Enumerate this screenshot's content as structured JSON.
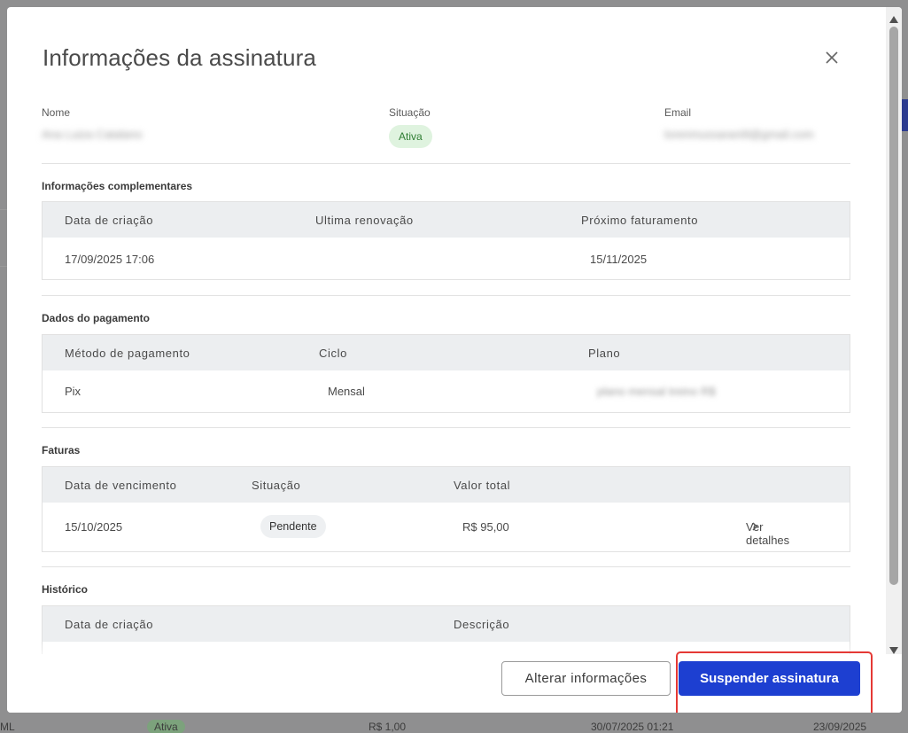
{
  "modal": {
    "title": "Informações da assinatura",
    "close_icon": "close-icon"
  },
  "summary": {
    "name_label": "Nome",
    "name_value": "Ana Luiza Catalano",
    "status_label": "Situação",
    "status_value": "Ativa",
    "email_label": "Email",
    "email_value": "lorenmussarani9@gmail.com"
  },
  "complementary": {
    "title": "Informações complementares",
    "headers": [
      "Data de criação",
      "Ultima renovação",
      "Próximo faturamento"
    ],
    "row": [
      "17/09/2025 17:06",
      "",
      "15/11/2025"
    ]
  },
  "payment": {
    "title": "Dados do pagamento",
    "headers": [
      "Método de pagamento",
      "Ciclo",
      "Plano"
    ],
    "row": [
      "Pix",
      "Mensal",
      "plano mensal treino R$"
    ]
  },
  "invoices": {
    "title": "Faturas",
    "headers": [
      "Data de vencimento",
      "Situação",
      "Valor total"
    ],
    "row": {
      "due_date": "15/10/2025",
      "status": "Pendente",
      "total": "R$ 95,00",
      "details_link": "Ver detalhes",
      "details_icon": "chevron-right-icon"
    }
  },
  "history": {
    "title": "Histórico",
    "headers": [
      "Data de criação",
      "Descrição"
    ]
  },
  "footer": {
    "edit_button": "Alterar informações",
    "suspend_button": "Suspender assinatura"
  },
  "background": {
    "row_fragment_1": "ML",
    "row_fragment_2": "Ativa",
    "row_fragment_3": "R$ 1,00",
    "row_fragment_4": "30/07/2025 01:21",
    "row_fragment_5": "23/09/2025"
  },
  "colors": {
    "primary": "#1d3fd1",
    "status_active_bg": "#dff3df",
    "status_active_text": "#2e7d32",
    "highlight": "#e53935"
  }
}
